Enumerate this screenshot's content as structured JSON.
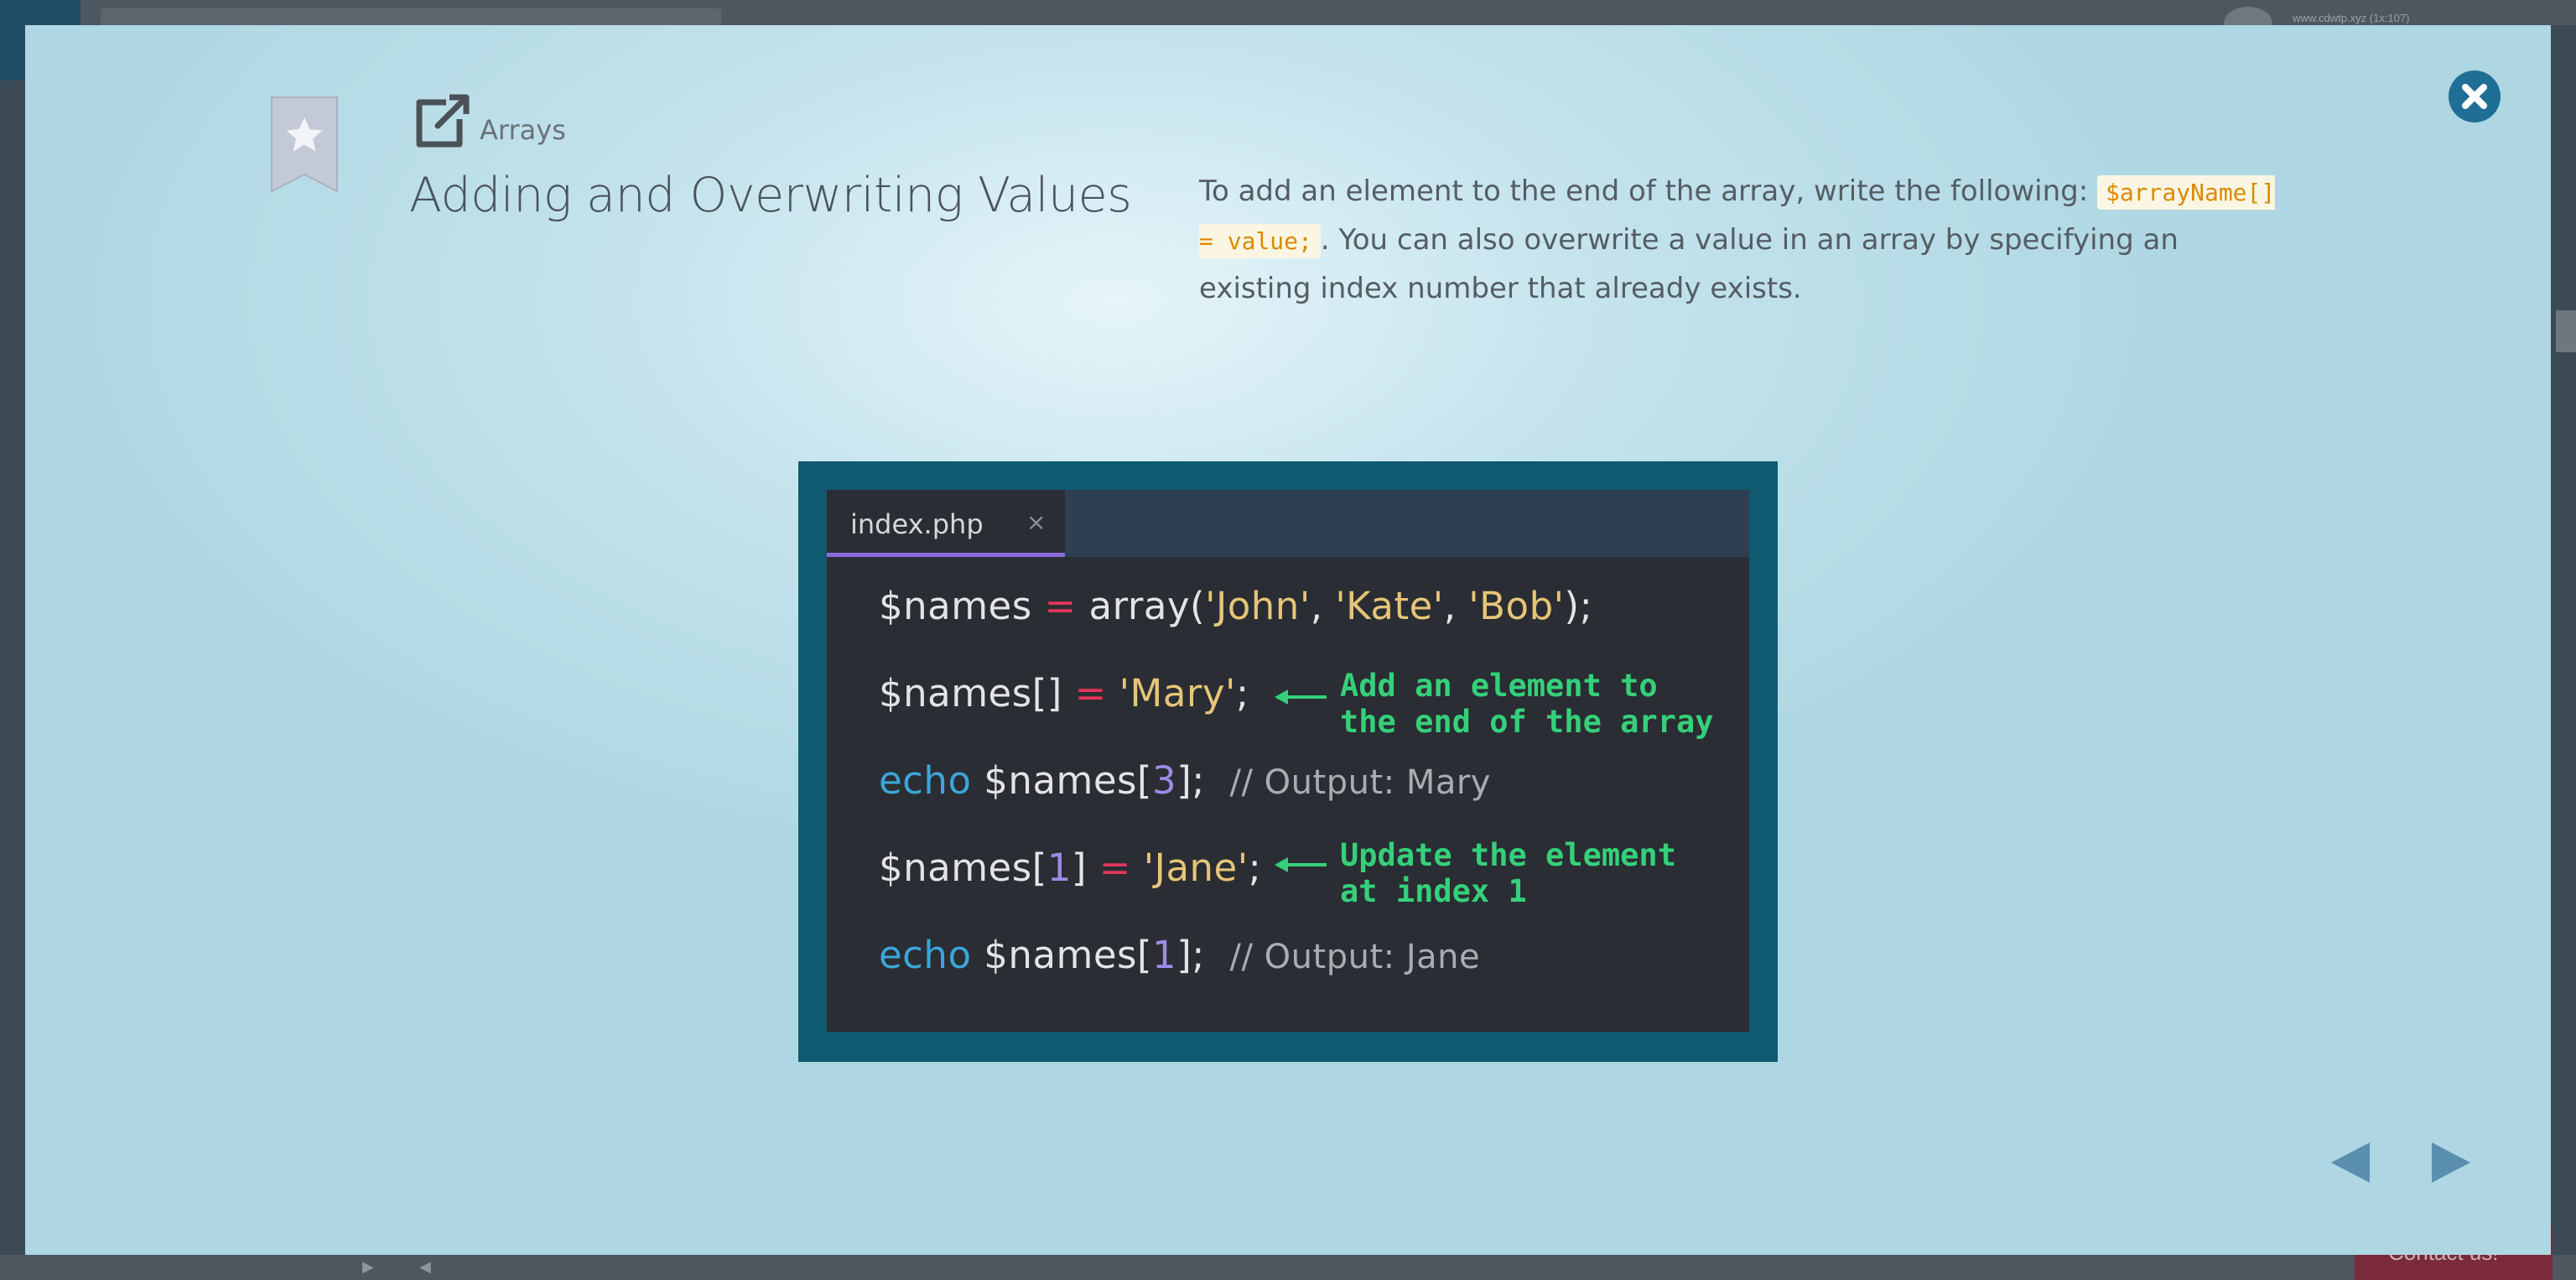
{
  "background": {
    "url_text": "www.cdwtp.xyz (1x:107)",
    "contact_label": "Contact us!",
    "scroll_left_arrow": "◀",
    "scroll_right_arrow": "▶"
  },
  "lesson": {
    "category": "Arrays",
    "title": "Adding and Overwriting Values",
    "description_before": "To add an element to the end of the array, write the following: ",
    "description_code": "$arrayName[] = value;",
    "description_after": ". You can also overwrite a value in an array by specifying an existing index number that already exists."
  },
  "code_image": {
    "tab_name": "index.php",
    "tab_close": "×",
    "line1": {
      "var": "$names",
      "op": "=",
      "fn": "array(",
      "s1": "'John'",
      "sep1": ", ",
      "s2": "'Kate'",
      "sep2": ", ",
      "s3": "'Bob'",
      "end": ");"
    },
    "line2": {
      "var": "$names[]",
      "op": "=",
      "str": "'Mary'",
      "end": ";"
    },
    "line3": {
      "kw": "echo",
      "var": "$names[",
      "num": "3",
      "end": "];",
      "comment": "// Output: Mary"
    },
    "line4": {
      "var": "$names[",
      "num": "1",
      "close": "]",
      "op": "=",
      "str": "'Jane'",
      "end": ";"
    },
    "line5": {
      "kw": "echo",
      "var": "$names[",
      "num": "1",
      "end": "];",
      "comment": "// Output: Jane"
    },
    "annotation1": "Add an element to\nthe end of the array",
    "annotation2": "Update the element\nat index 1"
  },
  "icons": {
    "bookmark": "bookmark-star-icon",
    "lesson": "external-link-icon",
    "close": "close-icon",
    "prev": "prev-arrow-icon",
    "next": "next-arrow-icon"
  },
  "colors": {
    "accent": "#1f6e95",
    "nav_arrow": "#5b8fb0",
    "code_frame": "#0f5a70",
    "annotation": "#35d07a",
    "inline_code": "#d98a00"
  }
}
